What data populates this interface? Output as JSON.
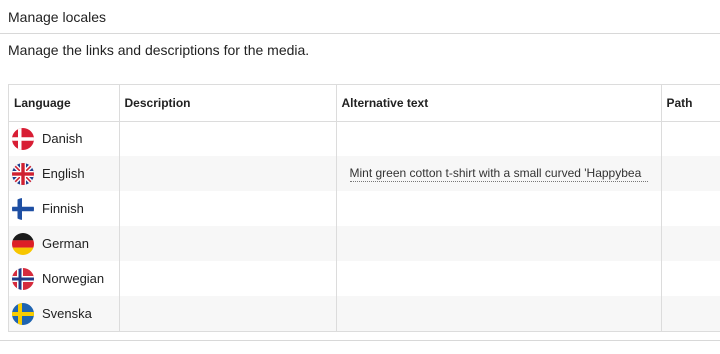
{
  "header": {
    "title": "Manage locales"
  },
  "intro": "Manage the links and descriptions for the media.",
  "table": {
    "columns": [
      "Language",
      "Description",
      "Alternative text",
      "Path"
    ],
    "rows": [
      {
        "language": "Danish",
        "flag": "danish-flag-icon",
        "description": "",
        "alt_text": "",
        "path": ""
      },
      {
        "language": "English",
        "flag": "uk-flag-icon",
        "description": "",
        "alt_text": "Mint green cotton t-shirt with a small curved 'Happybea",
        "path": ""
      },
      {
        "language": "Finnish",
        "flag": "finnish-flag-icon",
        "description": "",
        "alt_text": "",
        "path": ""
      },
      {
        "language": "German",
        "flag": "german-flag-icon",
        "description": "",
        "alt_text": "",
        "path": ""
      },
      {
        "language": "Norwegian",
        "flag": "norwegian-flag-icon",
        "description": "",
        "alt_text": "",
        "path": ""
      },
      {
        "language": "Svenska",
        "flag": "swedish-flag-icon",
        "description": "",
        "alt_text": "",
        "path": ""
      }
    ]
  }
}
